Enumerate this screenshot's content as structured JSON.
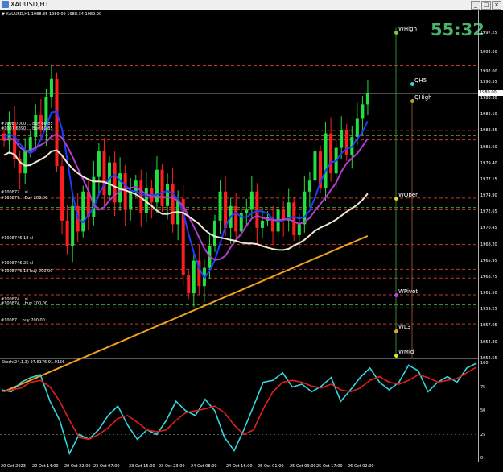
{
  "window": {
    "title": "XAUUSD,H1",
    "buttons": [
      "_",
      "□",
      "×"
    ]
  },
  "symbol_info": "▼ XAUUSD,H1  1988.35 1989.09 1988.34 1989.00",
  "timer": "55:32",
  "current_price": "1989.00",
  "price_ticks": [
    "1997.25",
    "1994.60",
    "1992.00",
    "1990.55",
    "1988.30",
    "1986.10",
    "1983.85",
    "1981.60",
    "1979.40",
    "1977.15",
    "1974.90",
    "1972.65",
    "1970.45",
    "1968.20",
    "1965.95",
    "1963.75",
    "1961.50",
    "1959.25",
    "1957.05",
    "1954.80",
    "1952.55"
  ],
  "stoch_label": "Stoch(24,1,3) 97.6176 91.9156",
  "osc_ticks": [
    "100",
    "75",
    "50",
    "25",
    "0"
  ],
  "time_ticks": [
    "20 Oct 2023",
    "20 Oct 14:00",
    "20 Oct 22:00",
    "23 Oct 07:00",
    "23 Oct 15:00",
    "23 Oct 23:00",
    "24 Oct 08:00",
    "24 Oct 16:00",
    "25 Oct 01:00",
    "25 Oct 09:00",
    "25 Oct 17:00",
    "26 Oct 02:00"
  ],
  "levels": [
    {
      "label": "WHigh",
      "color": "#7ec83a"
    },
    {
      "label": "QH5",
      "color": "#35d1e6"
    },
    {
      "label": "QHigh",
      "color": "#b9a22a"
    },
    {
      "label": "WOpen",
      "color": "#e0d23a"
    },
    {
      "label": "WPivot",
      "color": "#d23ae0"
    },
    {
      "label": "WL3",
      "color": "#e0a23a"
    },
    {
      "label": "WMid",
      "color": "#e0e23a"
    }
  ],
  "orders": [
    "#1008 7000 ... Buy 60.85",
    "#1007 6890 ... Buy 60.85",
    "#100877... sl",
    "#100877... Buy 200.00",
    "#1008746 18 sl",
    "#1008746 25 sl",
    "#1008746 18 buy 200.00",
    "#100874... sl",
    "#100874... buy 200.00",
    "#10087... buy 200.00"
  ],
  "chart_data": {
    "type": "candlestick",
    "symbol": "XAUUSD",
    "timeframe": "H1",
    "ylim": [
      1952.55,
      1999.5
    ],
    "close_last": 1989.0,
    "closes": [
      1982.5,
      1985.0,
      1980.0,
      1978.0,
      1981.0,
      1983.0,
      1986.0,
      1984.0,
      1988.5,
      1991.0,
      1979.0,
      1971.5,
      1968.0,
      1973.5,
      1970.0,
      1975.5,
      1972.0,
      1977.5,
      1981.0,
      1975.0,
      1979.5,
      1974.0,
      1978.0,
      1973.0,
      1975.5,
      1977.0,
      1972.5,
      1976.0,
      1974.0,
      1978.5,
      1973.5,
      1976.5,
      1971.0,
      1974.5,
      1964.0,
      1961.5,
      1966.0,
      1962.5,
      1965.0,
      1968.0,
      1971.5,
      1975.5,
      1970.5,
      1973.5,
      1970.0,
      1972.5,
      1973.0,
      1975.5,
      1970.5,
      1971.5,
      1972.0,
      1970.0,
      1973.0,
      1971.5,
      1974.0,
      1969.5,
      1971.0,
      1975.5,
      1977.0,
      1981.0,
      1976.0,
      1983.5,
      1978.0,
      1981.5,
      1984.0,
      1980.5,
      1983.0,
      1985.5,
      1987.5,
      1989.0
    ],
    "series": [
      {
        "name": "MA blue",
        "color": "#1f3bff"
      },
      {
        "name": "MA magenta",
        "color": "#b23ccf"
      },
      {
        "name": "MA white",
        "color": "#f1e6d2"
      },
      {
        "name": "MA orange",
        "color": "#f0a020"
      }
    ],
    "stoch": {
      "k_last": 97.6176,
      "d_last": 91.9156,
      "levels": [
        100,
        75,
        50,
        25,
        0
      ]
    }
  }
}
